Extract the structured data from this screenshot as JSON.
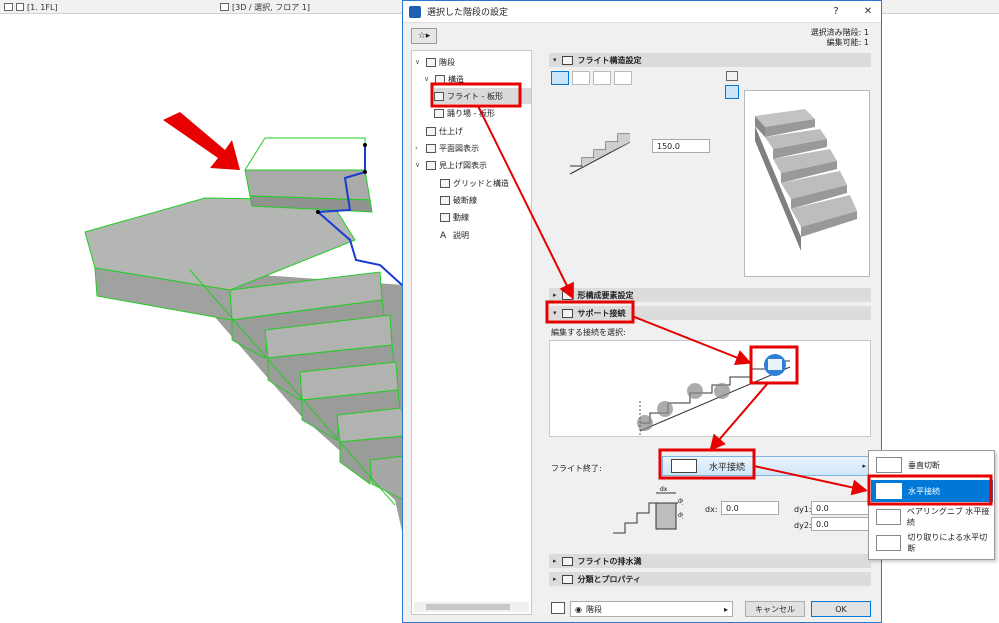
{
  "app_tabs": [
    {
      "label": "[1. 1FL]",
      "icon": "floor-plan-icon"
    },
    {
      "label": "[3D / 選択, フロア 1]",
      "icon": "3d-view-icon"
    }
  ],
  "dialog": {
    "title": "選択した階段の設定",
    "selection_info": [
      "選択済み階段: 1",
      "編集可能: 1"
    ],
    "tree": {
      "items": [
        {
          "label": "階段",
          "level": 0,
          "expanded": true,
          "icon": "stair-icon"
        },
        {
          "label": "構造",
          "level": 1,
          "expanded": true,
          "icon": "structure-icon"
        },
        {
          "label": "フライト - 板形",
          "level": 2,
          "selected": true,
          "icon": "flight-icon"
        },
        {
          "label": "踊り場 - 板形",
          "level": 2,
          "icon": "landing-icon"
        },
        {
          "label": "仕上げ",
          "level": 1,
          "icon": "finish-icon"
        },
        {
          "label": "平面図表示",
          "level": 1,
          "expanded": false,
          "icon": "plan-view-icon"
        },
        {
          "label": "見上げ図表示",
          "level": 1,
          "expanded": true,
          "icon": "reflected-view-icon"
        },
        {
          "label": "グリッドと構造",
          "level": 2,
          "icon": "grid-icon"
        },
        {
          "label": "破断線",
          "level": 2,
          "icon": "break-line-icon"
        },
        {
          "label": "動線",
          "level": 2,
          "icon": "walking-line-icon"
        },
        {
          "label": "説明",
          "level": 2,
          "icon": "description-icon"
        }
      ]
    },
    "sections": {
      "flight_structure": "フライト構造設定",
      "flight_thickness": "150.0",
      "components": "形構成要素設定",
      "support": "サポート接続",
      "edit_prompt": "編集する接続を選択:",
      "flight_end_label": "フライト終了:",
      "flight_end_value": "水平接続",
      "dx_label": "dx:",
      "dx_value": "0.0",
      "dy1_label": "dy1:",
      "dy1_value": "0.0",
      "dy2_label": "dy2:",
      "dy2_value": "0.0",
      "diagram_labels": {
        "dx": "dx",
        "dy1": "dy1",
        "dy2": "dy2"
      },
      "drainage": "フライトの排水溝",
      "classification": "分類とプロパティ"
    },
    "footer": {
      "layer_value": "階段",
      "cancel": "キャンセル",
      "ok": "OK"
    }
  },
  "popup_menu": {
    "items": [
      {
        "label": "垂直切断",
        "highlighted": false
      },
      {
        "label": "水平接続",
        "highlighted": true
      },
      {
        "label": "ベアリングニブ 水平接続",
        "highlighted": false
      },
      {
        "label": "切り取りによる水平切断",
        "highlighted": false
      }
    ]
  },
  "colors": {
    "highlight_frame": "#e60000",
    "selection_blue": "#0078d7",
    "stair_concrete": "#a9aca9",
    "edge_green": "#22cc22"
  }
}
